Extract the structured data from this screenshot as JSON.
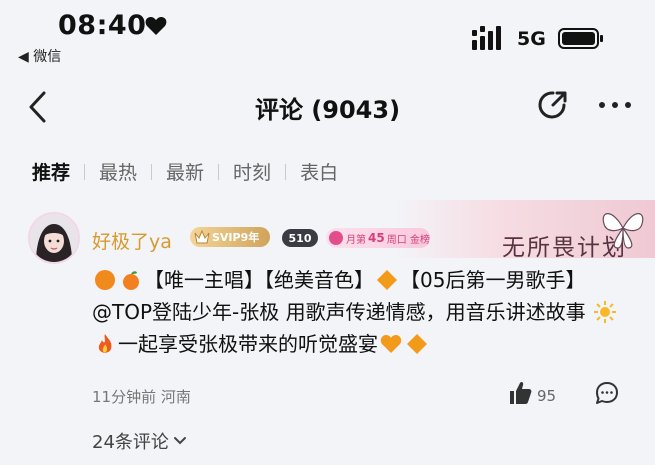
{
  "status_bar": {
    "time": "08:40",
    "network": "5G",
    "back_app": "◀ 微信"
  },
  "nav": {
    "title": "评论 (9043)"
  },
  "tabs": [
    {
      "label": "推荐",
      "active": true
    },
    {
      "label": "最热",
      "active": false
    },
    {
      "label": "最新",
      "active": false
    },
    {
      "label": "时刻",
      "active": false
    },
    {
      "label": "表白",
      "active": false
    }
  ],
  "comment": {
    "user_name": "好极了ya",
    "svip_badge": "SVIP9年",
    "level_badge": "510",
    "rank_badge": {
      "prefix": "月第",
      "number": "45",
      "suffix": "周口 金榜"
    },
    "decoration_text": "无所畏计划",
    "text_parts": [
      "【唯一主唱】【绝美音色】",
      "【05后第一男歌手】@TOP登陆少年-张极 用歌声传递情感，用音乐讲述故事",
      "一起享受张极带来的听觉盛宴"
    ],
    "meta": "11分钟前 河南",
    "like_count": "95",
    "replies_label": "24条评论"
  },
  "colors": {
    "accent_username": "#d89a2c",
    "background": "#f3f4f8"
  }
}
